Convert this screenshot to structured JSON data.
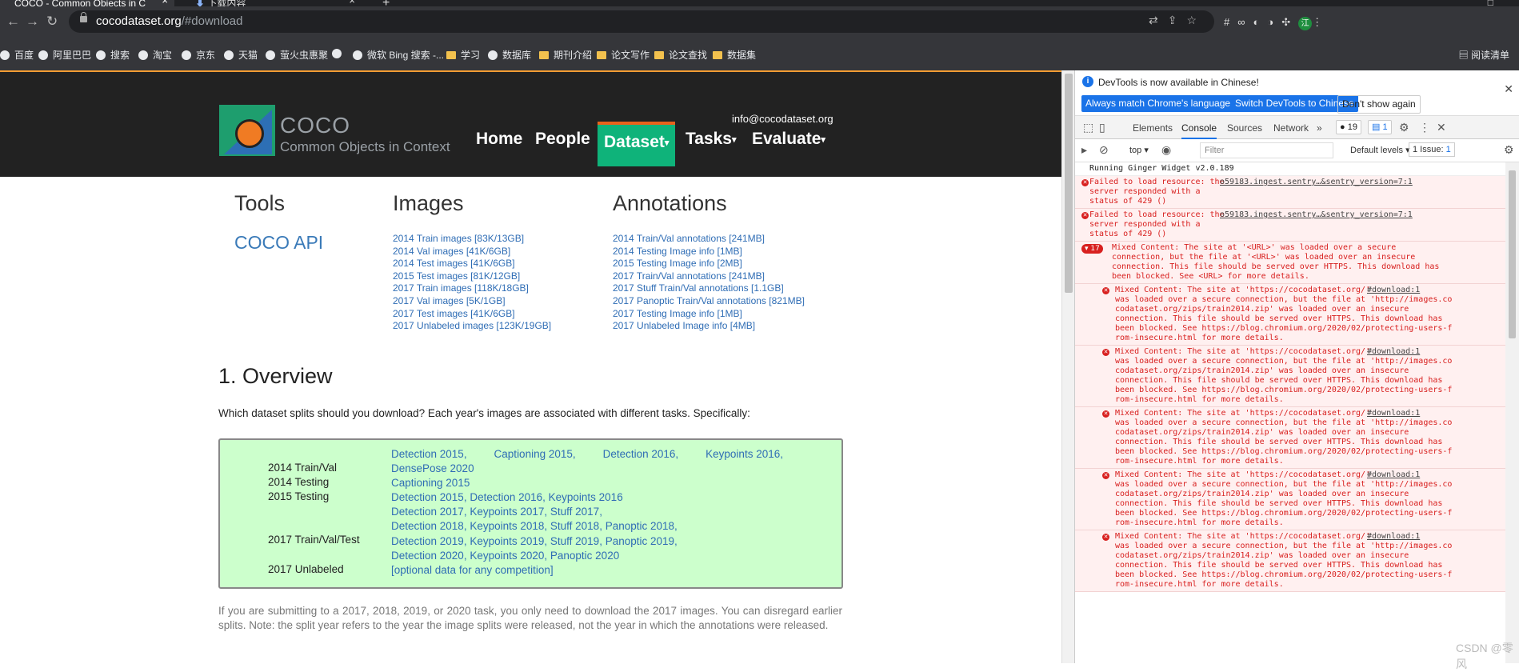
{
  "browser": {
    "tabs": [
      {
        "title": "COCO - Common Objects in C",
        "close": "×"
      },
      {
        "title": "下载内容",
        "close": "×"
      }
    ],
    "new_tab": "+",
    "url_host": "cocodataset.org",
    "url_path": "/#download",
    "bookmarks": [
      {
        "label": "百度",
        "type": "site"
      },
      {
        "label": "阿里巴巴",
        "type": "site"
      },
      {
        "label": "搜索",
        "type": "site"
      },
      {
        "label": "淘宝",
        "type": "site"
      },
      {
        "label": "京东",
        "type": "site"
      },
      {
        "label": "天猫",
        "type": "site"
      },
      {
        "label": "萤火虫惠聚",
        "type": "site"
      },
      {
        "label": "",
        "type": "site"
      },
      {
        "label": "微软 Bing 搜索 -...",
        "type": "site"
      },
      {
        "label": "学习",
        "type": "folder"
      },
      {
        "label": "数据库",
        "type": "site"
      },
      {
        "label": "期刊介绍",
        "type": "folder"
      },
      {
        "label": "论文写作",
        "type": "folder"
      },
      {
        "label": "论文查找",
        "type": "folder"
      },
      {
        "label": "数据集",
        "type": "folder"
      }
    ],
    "reading_list": "阅读清单",
    "avatar_initial": "江"
  },
  "site": {
    "logo_title": "COCO",
    "logo_subtitle": "Common Objects in Context",
    "email": "info@cocodataset.org",
    "nav": [
      {
        "label": "Home",
        "caret": ""
      },
      {
        "label": "People",
        "caret": ""
      },
      {
        "label": "Dataset",
        "caret": "▾"
      },
      {
        "label": "Tasks",
        "caret": "▾"
      },
      {
        "label": "Evaluate",
        "caret": "▾"
      }
    ]
  },
  "download": {
    "tools_heading": "Tools",
    "images_heading": "Images",
    "annotations_heading": "Annotations",
    "coco_api": "COCO API",
    "images": [
      "2014 Train images [83K/13GB]",
      "2014 Val images [41K/6GB]",
      "2014 Test images [41K/6GB]",
      "2015 Test images [81K/12GB]",
      "2017 Train images [118K/18GB]",
      "2017 Val images [5K/1GB]",
      "2017 Test images [41K/6GB]",
      "2017 Unlabeled images [123K/19GB]"
    ],
    "annotations": [
      "2014 Train/Val annotations [241MB]",
      "2014 Testing Image info [1MB]",
      "2015 Testing Image info [2MB]",
      "2017 Train/Val annotations [241MB]",
      "2017 Stuff Train/Val annotations [1.1GB]",
      "2017 Panoptic Train/Val annotations [821MB]",
      "2017 Testing Image info [1MB]",
      "2017 Unlabeled Image info [4MB]"
    ],
    "overview_heading": "1. Overview",
    "question": "Which dataset splits should you download? Each year's images are associated with different tasks. Specifically:",
    "splits": [
      {
        "label": "2014 Train/Val",
        "tasks": [
          "Detection 2015, Captioning 2015, Detection 2016, Keypoints 2016,",
          "DensePose 2020"
        ]
      },
      {
        "label": "2014 Testing",
        "tasks": [
          "Captioning 2015"
        ]
      },
      {
        "label": "2015 Testing",
        "tasks": [
          "Detection 2015, Detection 2016, Keypoints 2016"
        ]
      },
      {
        "label": "2017 Train/Val/Test",
        "tasks": [
          "Detection 2017, Keypoints 2017, Stuff 2017,",
          "Detection 2018, Keypoints 2018, Stuff 2018, Panoptic 2018,",
          "Detection 2019, Keypoints 2019, Stuff 2019, Panoptic 2019,",
          "Detection 2020, Keypoints 2020, Panoptic 2020"
        ]
      },
      {
        "label": "2017 Unlabeled",
        "tasks": [
          "[optional data for any competition]"
        ]
      }
    ],
    "note": "If you are submitting to a 2017, 2018, 2019, or 2020 task, you only need to download the 2017 images. You can disregard earlier splits. Note: the split year refers to the year the image splits were released, not the year in which the annotations were released."
  },
  "devtools": {
    "info_message": "DevTools is now available in Chinese!",
    "btn_match": "Always match Chrome's language",
    "btn_switch": "Switch DevTools to Chinese",
    "btn_dont_show": "Don't show again",
    "tabs": [
      "Elements",
      "Console",
      "Sources",
      "Network"
    ],
    "more_tabs": "»",
    "error_count": "19",
    "issue_count_badge": "1",
    "context": "top",
    "filter_placeholder": "Filter",
    "levels": "Default levels",
    "issues": "1 Issue:",
    "issues_count": "1",
    "console": {
      "info": "Running Ginger Widget v2.0.189",
      "errors": [
        {
          "msg": "Failed to load resource: the\nserver responded with a\nstatus of 429 ()",
          "src": "o59183.ingest.sentry…&sentry_version=7:1"
        },
        {
          "msg": "Failed to load resource: the\nserver responded with a\nstatus of 429 ()",
          "src": "o59183.ingest.sentry…&sentry_version=7:1"
        }
      ],
      "group_count": "17",
      "group_msg": "Mixed Content: The site at '<URL>' was loaded over a secure\nconnection, but the file at '<URL>' was loaded over an insecure\nconnection. This file should be served over HTTPS. This download has\nbeen blocked. See <URL> for more details.",
      "sub_src": "#download:1",
      "sub_msg": "Mixed Content: The site at 'https://cocodataset.org/'\nwas loaded over a secure connection, but the file at 'http://images.co\ncodataset.org/zips/train2014.zip' was loaded over an insecure\nconnection. This file should be served over HTTPS. This download has\nbeen blocked. See https://blog.chromium.org/2020/02/protecting-users-f\nrom-insecure.html for more details."
    }
  },
  "watermark": "CSDN @零风"
}
